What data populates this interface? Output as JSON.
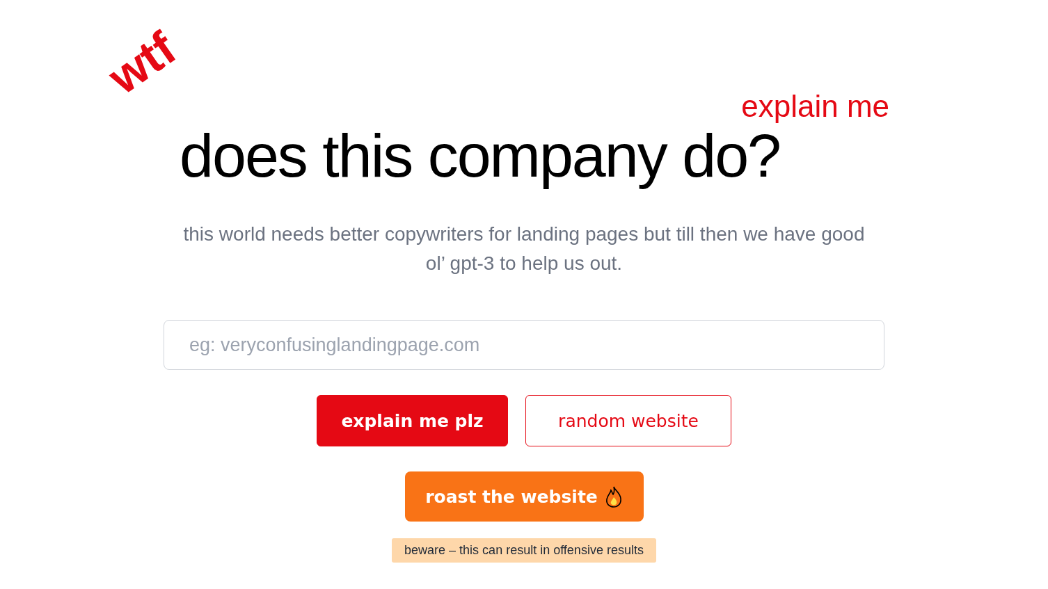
{
  "hero": {
    "tag": "wtf",
    "kicker": "explain me",
    "title": "does this company do?",
    "subtitle": "this world needs better copywriters for landing pages but till then we have good ol’ gpt-3 to help us out."
  },
  "search": {
    "placeholder": "eg: veryconfusinglandingpage.com"
  },
  "buttons": [
    {
      "label": "explain me plz",
      "kind": "primary"
    },
    {
      "label": "random website",
      "kind": "outline"
    }
  ],
  "roast": {
    "label": "roast the website"
  },
  "warning": "beware – this can result in offensive results"
}
